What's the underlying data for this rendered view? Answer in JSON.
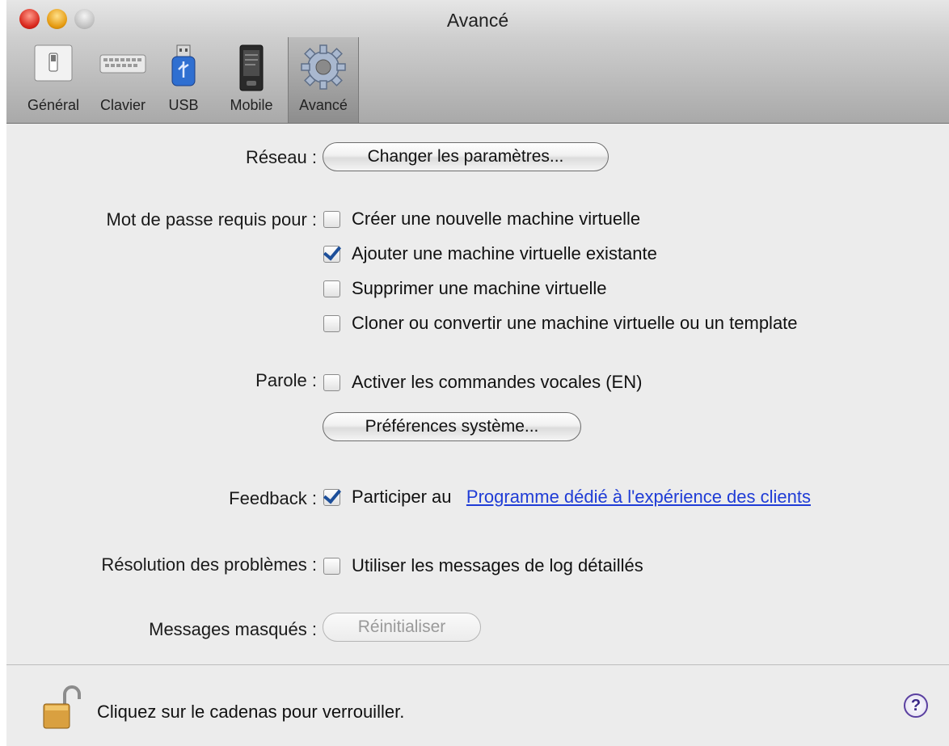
{
  "window": {
    "title": "Avancé"
  },
  "toolbar": {
    "items": [
      {
        "label": "Général",
        "icon": "general-switch-icon"
      },
      {
        "label": "Clavier",
        "icon": "keyboard-icon"
      },
      {
        "label": "USB",
        "icon": "usb-icon"
      },
      {
        "label": "Mobile",
        "icon": "mobile-phone-icon"
      },
      {
        "label": "Avancé",
        "icon": "gear-icon",
        "selected": true
      }
    ]
  },
  "network": {
    "label": "Réseau :",
    "button": "Changer les paramètres..."
  },
  "password": {
    "label": "Mot de passe requis pour :",
    "options": [
      {
        "text": "Créer une nouvelle machine virtuelle",
        "checked": false
      },
      {
        "text": "Ajouter une machine virtuelle existante",
        "checked": true
      },
      {
        "text": "Supprimer une machine virtuelle",
        "checked": false
      },
      {
        "text": "Cloner ou convertir une machine virtuelle ou un template",
        "checked": false
      }
    ]
  },
  "speech": {
    "label": "Parole :",
    "option": {
      "text": "Activer les commandes vocales (EN)",
      "checked": false
    },
    "button": "Préférences système..."
  },
  "feedback": {
    "label": "Feedback :",
    "option_text": "Participer au",
    "checked": true,
    "link": "Programme dédié à l'expérience des clients"
  },
  "troubleshooting": {
    "label": "Résolution des problèmes :",
    "option": {
      "text": "Utiliser les messages de log détaillés",
      "checked": false
    }
  },
  "hidden_messages": {
    "label": "Messages masqués :",
    "button": "Réinitialiser"
  },
  "footer": {
    "lock_text": "Cliquez sur le cadenas pour verrouiller.",
    "help": "?"
  },
  "colors": {
    "link": "#1f3cd6",
    "checkmark": "#1d4f9a",
    "help": "#5a3fa0"
  }
}
